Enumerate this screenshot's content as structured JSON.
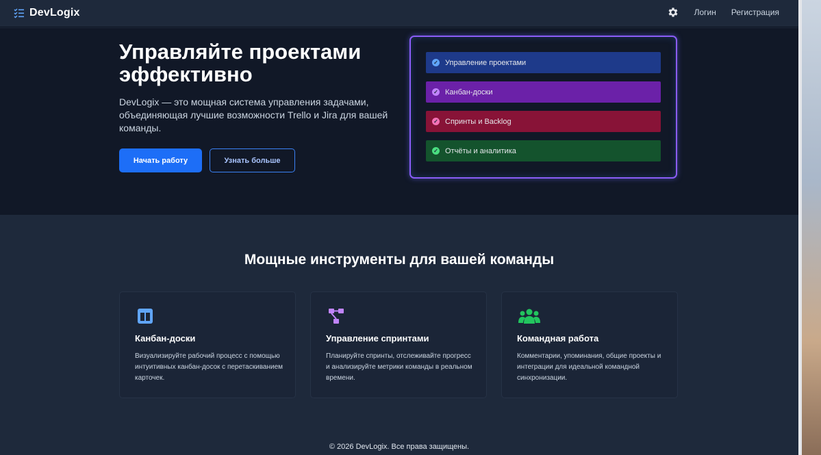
{
  "navbar": {
    "brand": "DevLogix",
    "login": "Логин",
    "register": "Регистрация"
  },
  "hero": {
    "title": "Управляйте проектами эффективно",
    "description": "DevLogix — это мощная система управления задачами, объединяющая лучшие возможности Trello и Jira для вашей команды.",
    "primary_button": "Начать работу",
    "secondary_button": "Узнать больше",
    "panel_items": [
      {
        "label": "Управление проектами",
        "bg": "#1e3a8a",
        "check": "#60a5fa"
      },
      {
        "label": "Канбан-доски",
        "bg": "#6b21a8",
        "check": "#c084fc"
      },
      {
        "label": "Спринты и Backlog",
        "bg": "#881337",
        "check": "#f472b6"
      },
      {
        "label": "Отчёты и аналитика",
        "bg": "#14532d",
        "check": "#4ade80"
      }
    ]
  },
  "features": {
    "title": "Мощные инструменты для вашей команды",
    "cards": [
      {
        "icon": "columns-icon",
        "title": "Канбан-доски",
        "text": "Визуализируйте рабочий процесс с помощью интуитивных канбан-досок с перетаскиванием карточек.",
        "color": "#60a5fa"
      },
      {
        "icon": "sitemap-icon",
        "title": "Управление спринтами",
        "text": "Планируйте спринты, отслеживайте прогресс и анализируйте метрики команды в реальном времени.",
        "color": "#c084fc"
      },
      {
        "icon": "users-icon",
        "title": "Командная работа",
        "text": "Комментарии, упоминания, общие проекты и интеграции для идеальной командной синхронизации.",
        "color": "#22c55e"
      }
    ]
  },
  "footer": {
    "copyright": "© 2026 DevLogix. Все права защищены."
  },
  "colors": {
    "accent": "#1d6ef7",
    "panel_border": "#8b5cf6"
  }
}
